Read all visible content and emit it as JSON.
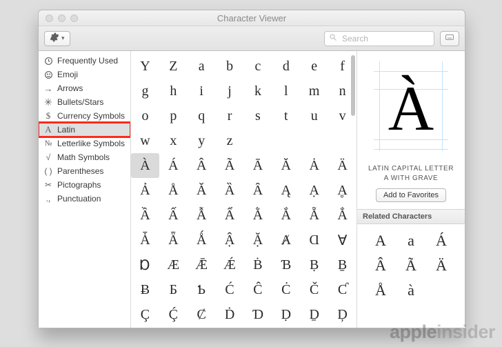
{
  "window": {
    "title": "Character Viewer"
  },
  "toolbar": {
    "search_placeholder": "Search",
    "add_favorites_label": "Add to Favorites"
  },
  "sidebar": {
    "selected_index": 5,
    "highlighted_index": 5,
    "items": [
      {
        "icon": "clock",
        "label": "Frequently Used"
      },
      {
        "icon": "smiley",
        "label": "Emoji"
      },
      {
        "icon": "arrow",
        "label": "Arrows"
      },
      {
        "icon": "asterisk",
        "label": "Bullets/Stars"
      },
      {
        "icon": "dollar",
        "label": "Currency Symbols"
      },
      {
        "icon": "A",
        "label": "Latin"
      },
      {
        "icon": "No",
        "label": "Letterlike Symbols"
      },
      {
        "icon": "root",
        "label": "Math Symbols"
      },
      {
        "icon": "parens",
        "label": "Parentheses"
      },
      {
        "icon": "pictograph",
        "label": "Pictographs"
      },
      {
        "icon": "comma",
        "label": "Punctuation"
      }
    ]
  },
  "grid": {
    "selected_index": 32,
    "chars": [
      "Y",
      "Z",
      "a",
      "b",
      "c",
      "d",
      "e",
      "f",
      "g",
      "h",
      "i",
      "j",
      "k",
      "l",
      "m",
      "n",
      "o",
      "p",
      "q",
      "r",
      "s",
      "t",
      "u",
      "v",
      "w",
      "x",
      "y",
      "z",
      "",
      "",
      "",
      "",
      "À",
      "Á",
      "Â",
      "Ã",
      "Ā",
      "Ă",
      "Ȧ",
      "Ä",
      "Ả",
      "Å",
      "Ǎ",
      "Ȁ",
      "Ȃ",
      "Ą",
      "Ạ",
      "Ḁ",
      "Ầ",
      "Ấ",
      "Ẫ",
      "Ẩ",
      "Ằ",
      "Ắ",
      "Ẵ",
      "Ẳ",
      "Ǡ",
      "Ǟ",
      "Ǻ",
      "Ậ",
      "Ặ",
      "Ⱥ",
      "Ɑ",
      "Ɐ",
      "Ɒ",
      "Æ",
      "Ǣ",
      "Ǽ",
      "Ḃ",
      "Ɓ",
      "Ḅ",
      "Ḇ",
      "Ƀ",
      "Ƃ",
      "Ƅ",
      "Ć",
      "Ĉ",
      "Ċ",
      "Č",
      "Ƈ",
      "Ç",
      "Ḉ",
      "Ȼ",
      "Ḋ",
      "Ɗ",
      "Ḍ",
      "Ḏ",
      "Ḑ"
    ]
  },
  "detail": {
    "glyph": "À",
    "name": "LATIN CAPITAL LETTER A WITH GRAVE",
    "related_header": "Related Characters",
    "related": [
      "A",
      "a",
      "Á",
      "Â",
      "Ã",
      "Ä",
      "Å",
      "à"
    ]
  },
  "watermark": {
    "brand_bold": "apple",
    "brand_light": "insider"
  }
}
